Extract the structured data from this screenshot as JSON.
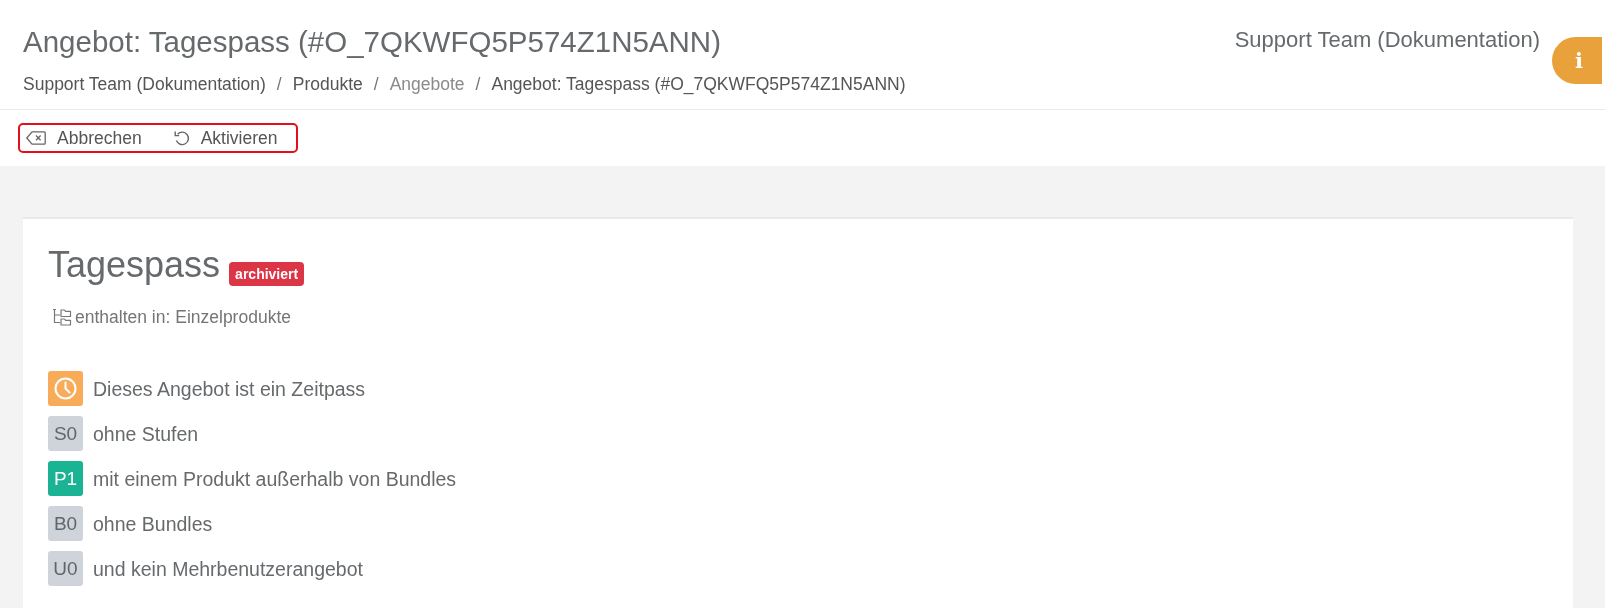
{
  "header": {
    "title": "Angebot: Tagespass (#O_7QKWFQ5P574Z1N5ANN)",
    "breadcrumb": [
      {
        "label": "Support Team (Dokumentation)",
        "muted": false
      },
      {
        "separator": "/",
        "label": "Produkte",
        "muted": false
      },
      {
        "separator": "/",
        "label": "Angebote",
        "muted": true
      },
      {
        "separator": "/",
        "label": "Angebot: Tagespass (#O_7QKWFQ5P574Z1N5ANN)",
        "muted": false
      }
    ],
    "team": "Support Team (Dokumentation)",
    "info_button": "i"
  },
  "toolbar": {
    "highlighted": true,
    "buttons": [
      {
        "kind": "cancel",
        "label": "Abbrechen"
      },
      {
        "kind": "restore",
        "label": "Aktivieren"
      }
    ]
  },
  "offer": {
    "name": "Tagespass",
    "status": "archiviert",
    "contained_in": "enthalten in: Einzelprodukte",
    "features": [
      {
        "kind": "clock",
        "color": "#f8ac59",
        "text": "Dieses Angebot ist ein Zeitpass"
      },
      {
        "kind": "code",
        "code": "S0",
        "color": "#cfd3da",
        "text": "ohne Stufen"
      },
      {
        "kind": "code",
        "code": "P1",
        "color": "#1ab394",
        "text": "mit einem Produkt außerhalb von Bundles"
      },
      {
        "kind": "code",
        "code": "B0",
        "color": "#cfd3da",
        "text": "ohne Bundles"
      },
      {
        "kind": "code",
        "code": "U0",
        "color": "#cfd3da",
        "text": "und kein Mehrbenutzerangebot"
      }
    ]
  }
}
